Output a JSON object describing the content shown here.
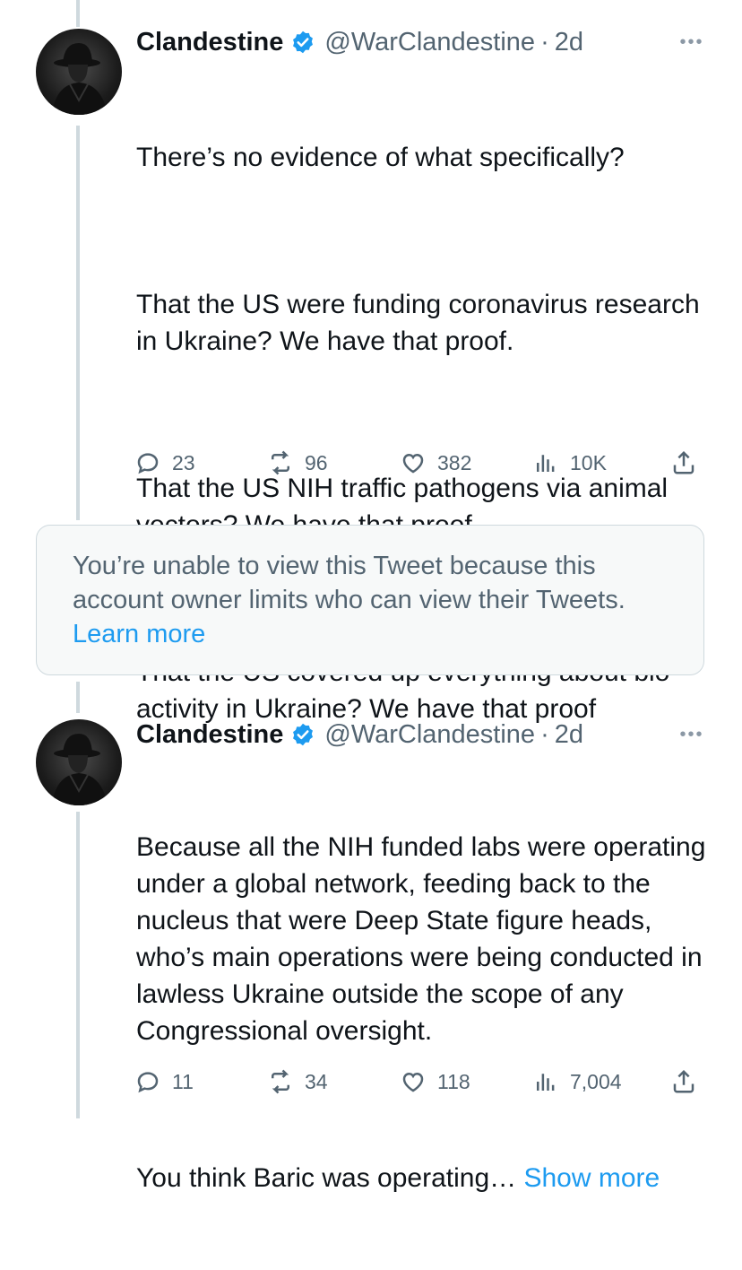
{
  "tweet1": {
    "name": "Clandestine",
    "handle": "@WarClandestine",
    "time": "2d",
    "paragraphs": [
      "There’s no evidence of what specifically?",
      "That the US were funding coronavirus research in Ukraine? We have that proof.",
      "That the US NIH traffic pathogens via animal vectors? We have that proof.",
      "That the US covered up everything about bio-activity in Ukraine? We have that proof"
    ],
    "stats": {
      "replies": "23",
      "retweets": "96",
      "likes": "382",
      "views": "10K"
    }
  },
  "restricted": {
    "message": "You’re unable to view this Tweet because this account owner limits who can view their Tweets.",
    "link": "Learn more"
  },
  "tweet2": {
    "name": "Clandestine",
    "handle": "@WarClandestine",
    "time": "2d",
    "paragraphs": [
      "Because all the NIH funded labs were operating under a global network, feeding back to the nucleus that were Deep State figure heads, who’s main operations were being conducted in lawless Ukraine outside the scope of any Congressional oversight."
    ],
    "truncated": "You think Baric was operating…",
    "show_more": "Show more",
    "stats": {
      "replies": "11",
      "retweets": "34",
      "likes": "118",
      "views": "7,004"
    }
  },
  "icons": {
    "reply": "reply-icon",
    "retweet": "retweet-icon",
    "like": "heart-icon",
    "views": "views-icon",
    "share": "share-icon",
    "more": "more-icon",
    "verified": "verified-badge-icon"
  },
  "colors": {
    "accent": "#1d9bf0",
    "secondary": "#536471",
    "border": "#cfd9de"
  }
}
